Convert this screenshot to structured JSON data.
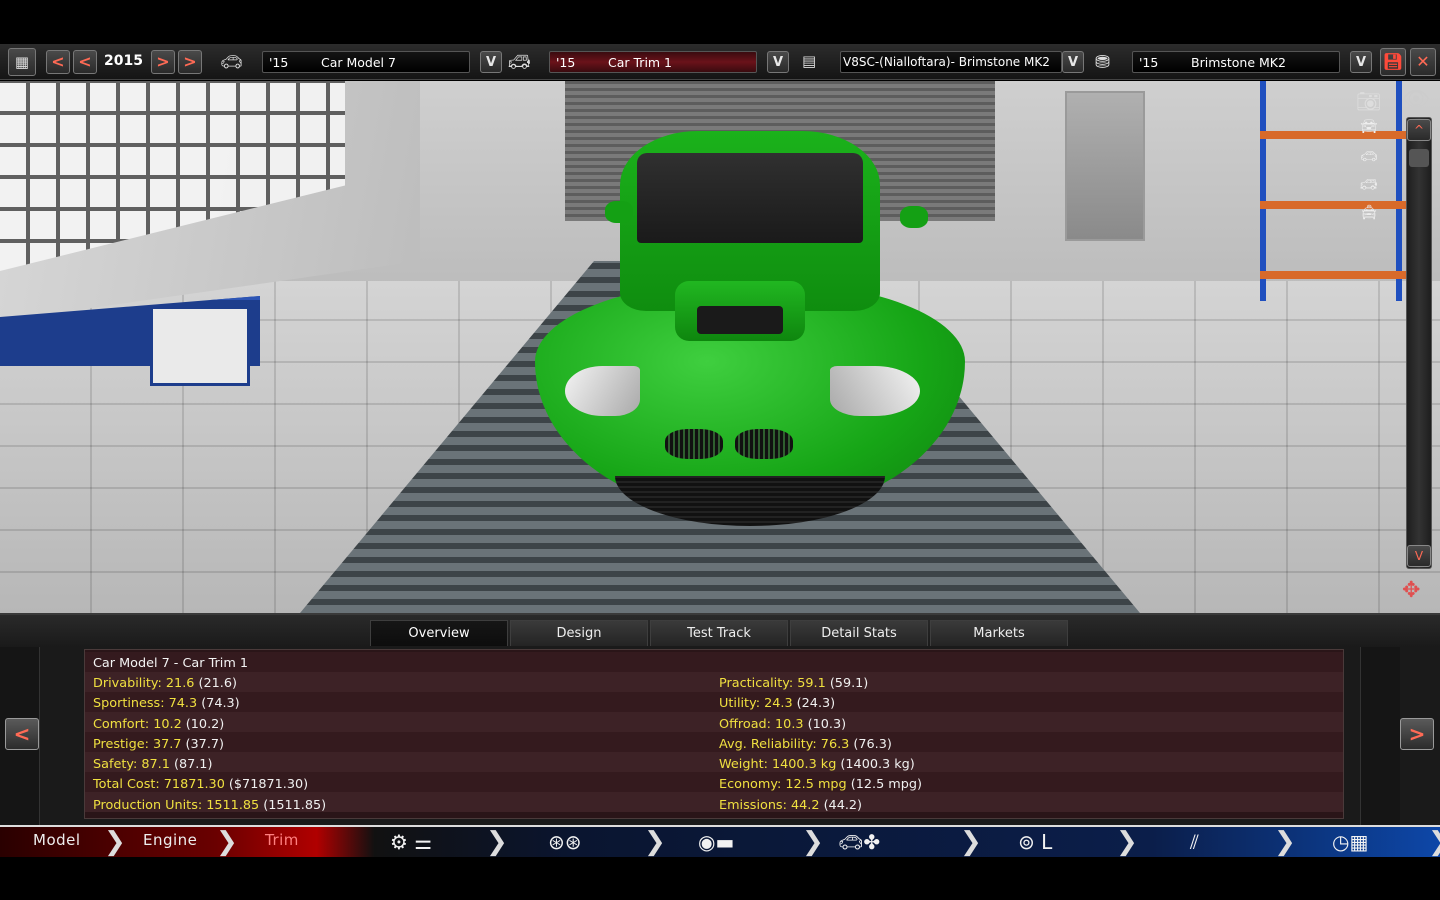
{
  "toolbar": {
    "year": "2015",
    "model": {
      "year": "'15",
      "name": "Car Model 7"
    },
    "trim": {
      "year": "'15",
      "name": "Car Trim 1"
    },
    "engine": {
      "name": "V8SC-(Nialloftara)- Brimstone MK2"
    },
    "engine_family": {
      "year": "'15",
      "name": "Brimstone MK2"
    },
    "dropdown_glyph": "V",
    "prev_glyph": "<",
    "next_glyph": ">",
    "close_glyph": "✕"
  },
  "viewport": {
    "scroll_up": "^",
    "scroll_down": "V"
  },
  "tabs": [
    {
      "label": "Overview",
      "active": true
    },
    {
      "label": "Design",
      "active": false
    },
    {
      "label": "Test Track",
      "active": false
    },
    {
      "label": "Detail Stats",
      "active": false
    },
    {
      "label": "Markets",
      "active": false
    }
  ],
  "overview": {
    "title": "Car Model 7 - Car Trim 1",
    "left": [
      {
        "label": "Drivability: 21.6",
        "alt": "(21.6)"
      },
      {
        "label": "Sportiness: 74.3",
        "alt": "(74.3)"
      },
      {
        "label": "Comfort: 10.2",
        "alt": "(10.2)"
      },
      {
        "label": "Prestige: 37.7",
        "alt": "(37.7)"
      },
      {
        "label": "Safety: 87.1",
        "alt": "(87.1)"
      },
      {
        "label": "Total Cost: 71871.30",
        "alt": "($71871.30)"
      },
      {
        "label": "Production Units: 1511.85",
        "alt": "(1511.85)"
      }
    ],
    "right": [
      {
        "label": "Practicality: 59.1",
        "alt": "(59.1)"
      },
      {
        "label": "Utility: 24.3",
        "alt": "(24.3)"
      },
      {
        "label": "Offroad: 10.3",
        "alt": "(10.3)"
      },
      {
        "label": "Avg. Reliability: 76.3",
        "alt": "(76.3)"
      },
      {
        "label": "Weight: 1400.3 kg",
        "alt": "(1400.3 kg)"
      },
      {
        "label": "Economy: 12.5 mpg",
        "alt": "(12.5 mpg)"
      },
      {
        "label": "Emissions: 44.2",
        "alt": "(44.2)"
      }
    ],
    "prev_glyph": "<",
    "next_glyph": ">"
  },
  "nav": {
    "items": [
      {
        "label": "Model"
      },
      {
        "label": "Engine"
      },
      {
        "label": "Trim",
        "active": true
      }
    ],
    "chevron": "❯",
    "icons": [
      "chassis-icon",
      "wheels-icon",
      "body-icon",
      "aero-icon",
      "interior-icon",
      "suspension-icon",
      "test-finish-icon"
    ]
  }
}
